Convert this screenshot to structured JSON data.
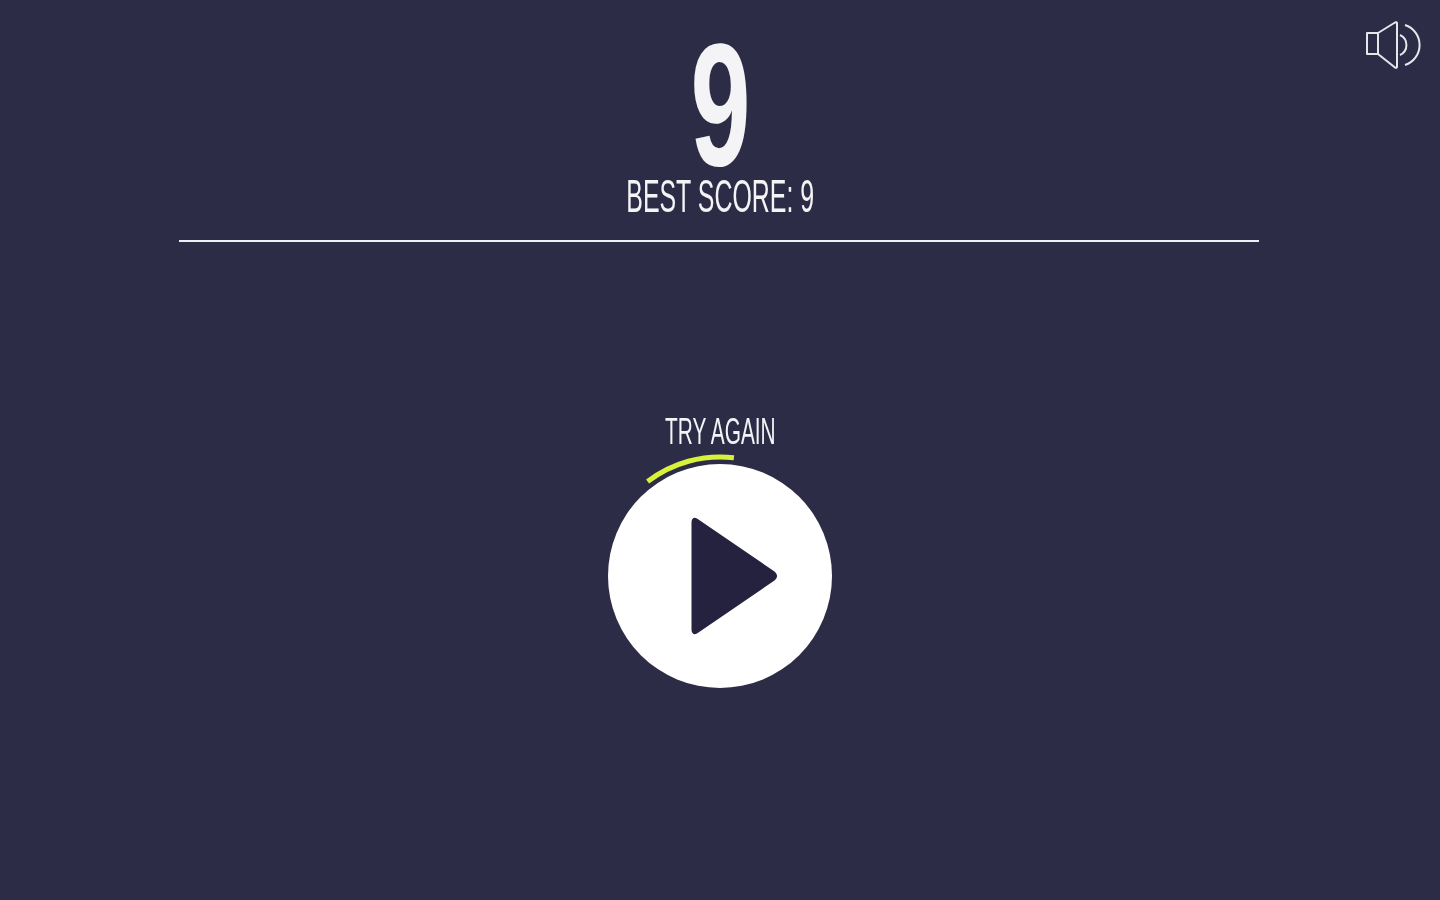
{
  "score": "9",
  "best_score": "BEST SCORE: 9",
  "prompt": "TRY AGAIN",
  "sound": {
    "on": true
  }
}
